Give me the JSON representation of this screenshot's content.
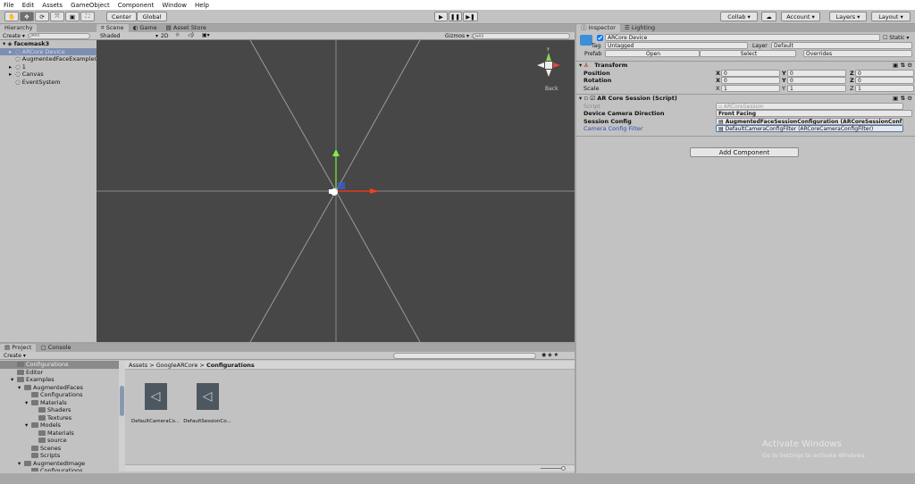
{
  "menu": [
    "File",
    "Edit",
    "Assets",
    "GameObject",
    "Component",
    "Window",
    "Help"
  ],
  "toolbar": {
    "pivot": "Center",
    "space": "Global",
    "collab": "Collab ▾",
    "account": "Account",
    "layers": "Layers",
    "layout": "Layout"
  },
  "hierarchy": {
    "tab": "Hierarchy",
    "create": "Create ▾",
    "search_placeholder": "Q▾All",
    "scene": "facemask3",
    "items": [
      {
        "label": "ARCore Device",
        "selected": true,
        "expandable": true
      },
      {
        "label": "AugmentedFaceExampleCo",
        "selected": false,
        "expandable": false
      },
      {
        "label": "1",
        "selected": false,
        "expandable": true
      },
      {
        "label": "Canvas",
        "selected": false,
        "expandable": true
      },
      {
        "label": "EventSystem",
        "selected": false,
        "expandable": false
      }
    ]
  },
  "scene": {
    "tabs": [
      "Scene",
      "Game",
      "Asset Store"
    ],
    "shading": "Shaded",
    "mode2d": "2D",
    "gizmos": "Gizmos ▾",
    "search_placeholder": "Q▾All",
    "gizmo_label": "Back",
    "gizmo_y": "y"
  },
  "inspector": {
    "tabs": [
      "Inspector",
      "Lighting"
    ],
    "object_name": "ARCore Device",
    "static": "Static",
    "tag_label": "Tag",
    "tag": "Untagged",
    "layer_label": "Layer",
    "layer": "Default",
    "prefab_label": "Prefab",
    "prefab_open": "Open",
    "prefab_select": "Select",
    "prefab_overrides": "Overrides",
    "transform": {
      "title": "Transform",
      "rows": [
        {
          "label": "Position",
          "x": "0",
          "y": "0",
          "z": "0"
        },
        {
          "label": "Rotation",
          "x": "0",
          "y": "0",
          "z": "0"
        },
        {
          "label": "Scale",
          "x": "1",
          "y": "1",
          "z": "1"
        }
      ]
    },
    "session": {
      "title": "AR Core Session (Script)",
      "script_label": "Script",
      "script_value": "ARCoreSession",
      "dir_label": "Device Camera Direction",
      "dir_value": "Front Facing",
      "config_label": "Session Config",
      "config_value": "AugmentedFaceSessionConfiguration (ARCoreSessionConf",
      "filter_label": "Camera Config Filter",
      "filter_value": "DefaultCameraConfigFilter (ARCoreCameraConfigFilter)"
    },
    "add_component": "Add Component"
  },
  "project": {
    "tabs": [
      "Project",
      "Console"
    ],
    "create": "Create ▾",
    "breadcrumb": [
      "Assets",
      "GoogleARCore",
      "Configurations"
    ],
    "tree": [
      {
        "label": "Configurations",
        "depth": 2,
        "selected": true
      },
      {
        "label": "Editor",
        "depth": 2
      },
      {
        "label": "Examples",
        "depth": 2,
        "open": true
      },
      {
        "label": "AugmentedFaces",
        "depth": 3,
        "open": true
      },
      {
        "label": "Configurations",
        "depth": 4
      },
      {
        "label": "Materials",
        "depth": 4,
        "open": true
      },
      {
        "label": "Shaders",
        "depth": 5
      },
      {
        "label": "Textures",
        "depth": 5
      },
      {
        "label": "Models",
        "depth": 4,
        "open": true
      },
      {
        "label": "Materials",
        "depth": 5
      },
      {
        "label": "source",
        "depth": 5
      },
      {
        "label": "Scenes",
        "depth": 4
      },
      {
        "label": "Scripts",
        "depth": 4
      },
      {
        "label": "AugmentedImage",
        "depth": 3,
        "open": true
      },
      {
        "label": "Configurations",
        "depth": 4
      }
    ],
    "assets": [
      "DefaultCameraCo...",
      "DefaultSessionCo..."
    ]
  },
  "watermark": {
    "title": "Activate Windows",
    "subtitle": "Go to Settings to activate Windows."
  }
}
